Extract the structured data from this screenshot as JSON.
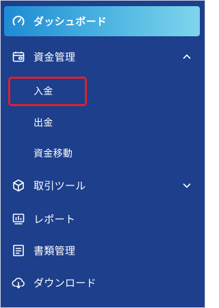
{
  "sidebar": {
    "dashboard": {
      "label": "ダッシュボード",
      "icon": "dashboard-gauge-icon",
      "state": "active"
    },
    "funds_management": {
      "label": "資金管理",
      "icon": "wallet-icon",
      "expanded": true,
      "chevron": "chevron-up-icon",
      "children": [
        {
          "label": "入金",
          "highlighted": true
        },
        {
          "label": "出金"
        },
        {
          "label": "資金移動"
        }
      ]
    },
    "trading_tools": {
      "label": "取引ツール",
      "icon": "cube-icon",
      "chevron": "chevron-down-icon"
    },
    "reports": {
      "label": "レポート",
      "icon": "chart-report-icon"
    },
    "documents": {
      "label": "書類管理",
      "icon": "document-list-icon"
    },
    "download": {
      "label": "ダウンロード",
      "icon": "cloud-download-icon"
    }
  },
  "colors": {
    "sidebar_bg": "#1d3f8c",
    "active_gradient_start": "#1e8bd3",
    "active_gradient_end": "#7fd5ec",
    "highlight_border": "#e0202a",
    "text": "#ffffff"
  }
}
